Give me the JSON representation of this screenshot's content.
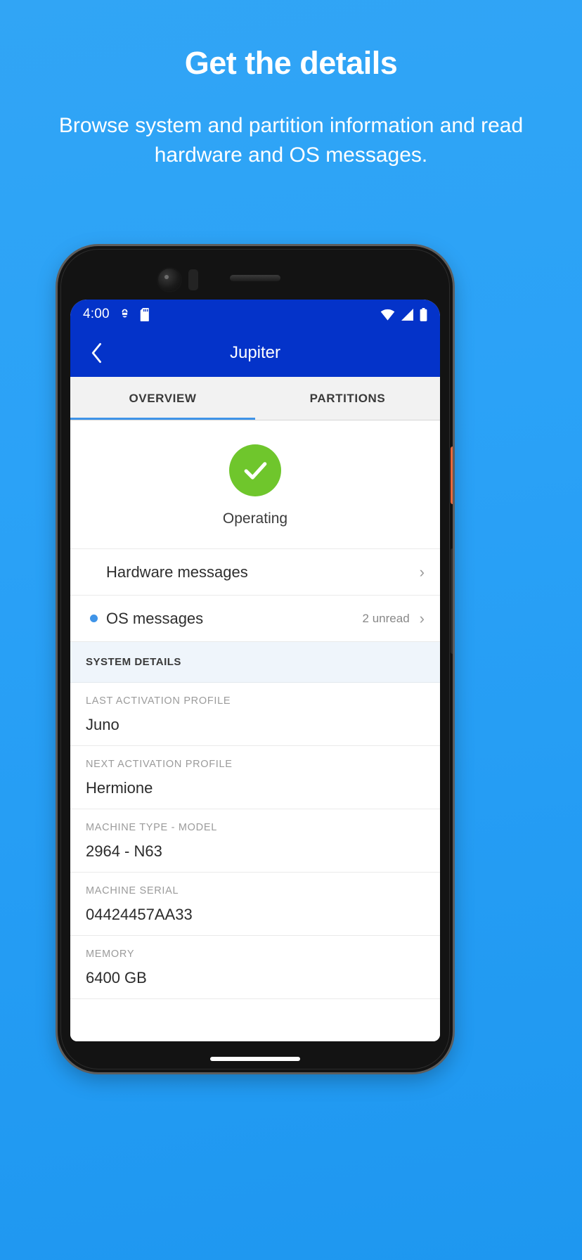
{
  "promo": {
    "title": "Get the details",
    "subtitle": "Browse system and partition information and read hardware and OS messages.",
    "background_color": "#2BA2F7"
  },
  "phone": {
    "status_bar": {
      "time": "4:00",
      "left_icons": [
        "android-debug-icon",
        "sd-card-icon"
      ],
      "right_icons": [
        "wifi-icon",
        "cellular-signal-icon",
        "battery-icon"
      ],
      "background_color": "#0433C9"
    },
    "app_bar": {
      "back_icon": "chevron-left-icon",
      "title": "Jupiter",
      "background_color": "#0433C9"
    },
    "tabs": {
      "items": [
        {
          "label": "OVERVIEW",
          "selected": true
        },
        {
          "label": "PARTITIONS",
          "selected": false
        }
      ],
      "indicator_color": "#3F94E8"
    },
    "overview": {
      "status": {
        "icon": "check-circle-icon",
        "label": "Operating",
        "color": "#6FC62C"
      },
      "nav_rows": [
        {
          "label": "Hardware messages",
          "meta": "",
          "has_unread_dot": false,
          "chevron": "›"
        },
        {
          "label": "OS messages",
          "meta": "2 unread",
          "has_unread_dot": true,
          "chevron": "›"
        }
      ],
      "section_header": "SYSTEM DETAILS",
      "details": [
        {
          "key": "LAST ACTIVATION PROFILE",
          "value": "Juno"
        },
        {
          "key": "NEXT ACTIVATION PROFILE",
          "value": "Hermione"
        },
        {
          "key": "MACHINE TYPE - MODEL",
          "value": "2964 - N63"
        },
        {
          "key": "MACHINE SERIAL",
          "value": "04424457AA33"
        },
        {
          "key": "MEMORY",
          "value": "6400 GB"
        }
      ]
    }
  }
}
